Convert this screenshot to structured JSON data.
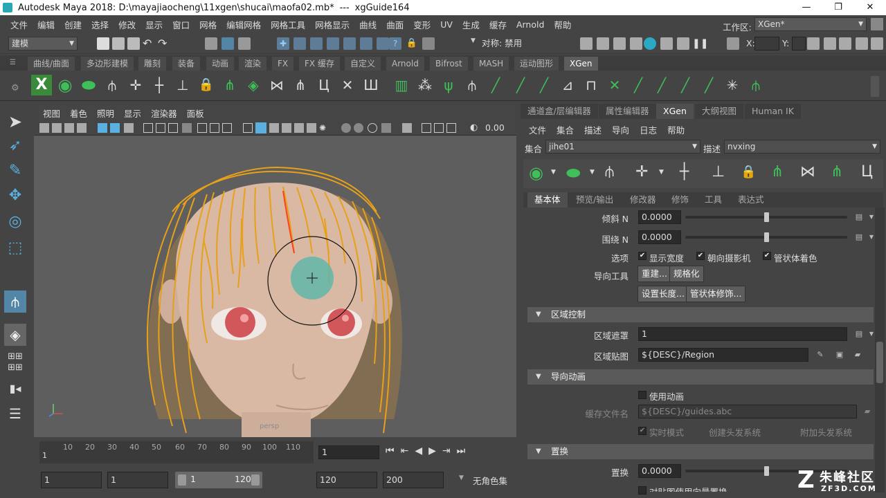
{
  "window": {
    "app_title": "Autodesk Maya 2018: D:\\mayajiaocheng\\11xgen\\shucai\\maofa02.mb*",
    "separator": "---",
    "doc_title": "xgGuide164"
  },
  "menubar": [
    "文件",
    "编辑",
    "创建",
    "选择",
    "修改",
    "显示",
    "窗口",
    "网格",
    "编辑网格",
    "网格工具",
    "网格显示",
    "曲线",
    "曲面",
    "变形",
    "UV",
    "生成",
    "缓存",
    "Arnold",
    "帮助"
  ],
  "status_line": {
    "mode": "建模",
    "symmetry": "对称: 禁用",
    "x_label": "X:",
    "y_label": "Y:",
    "workspace_label": "工作区:",
    "workspace_value": "XGen*"
  },
  "shelf_tabs": [
    "曲线/曲面",
    "多边形建模",
    "雕刻",
    "装备",
    "动画",
    "渲染",
    "FX",
    "FX 缓存",
    "自定义",
    "Arnold",
    "Bifrost",
    "MASH",
    "运动图形",
    "XGen"
  ],
  "shelf_active": "XGen",
  "viewport": {
    "menu": [
      "视图",
      "着色",
      "照明",
      "显示",
      "渲染器",
      "面板"
    ],
    "exposure_value": "0.00",
    "camera_label": "persp"
  },
  "timeline": {
    "ticks": [
      "10",
      "20",
      "30",
      "40",
      "50",
      "60",
      "70",
      "80",
      "90",
      "100",
      "110"
    ],
    "start_tick": "1",
    "current_frame": "1"
  },
  "range": {
    "start": "1",
    "playback_start": "1",
    "slider_start": "1",
    "slider_end": "120",
    "playback_end": "120",
    "end": "200",
    "character_set": "无角色集"
  },
  "panel": {
    "tabs": [
      "通道盒/层编辑器",
      "属性编辑器",
      "XGen",
      "大纲视图",
      "Human IK"
    ],
    "active_tab": "XGen",
    "menu": [
      "文件",
      "集合",
      "描述",
      "导向",
      "日志",
      "帮助"
    ],
    "collection_label": "集合",
    "collection_value": "jihe01",
    "description_label": "描述",
    "description_value": "nvxing",
    "subtabs": [
      "基本体",
      "预览/输出",
      "修改器",
      "修饰",
      "工具",
      "表达式"
    ],
    "active_subtab": "基本体",
    "lean_label": "倾斜 N",
    "lean_value": "0.0000",
    "lean_level": 0.5,
    "twist_label": "围绕 N",
    "twist_value": "0.0000",
    "twist_level": 0.5,
    "options_label": "选项",
    "opt_show_width": "显示宽度",
    "opt_face_camera": "朝向摄影机",
    "opt_tube_shade": "管状体着色",
    "guide_tools_label": "导向工具",
    "btn_rebuild": "重建...",
    "btn_normalize": "规格化",
    "btn_set_length": "设置长度...",
    "btn_tube_fix": "管状体修饰...",
    "section_region": "区域控制",
    "region_mask_label": "区域遮罩",
    "region_mask_value": "1",
    "region_map_label": "区域贴图",
    "region_map_value": "${DESC}/Region",
    "section_guide_anim": "导向动画",
    "use_anim": "使用动画",
    "cache_file_label": "缓存文件名",
    "cache_file_value": "${DESC}/guides.abc",
    "live_mode": "实时模式",
    "create_hair_system": "创建头发系统",
    "attach_hair_system": "附加头发系统",
    "section_displace": "置换",
    "displace_label": "置换",
    "displace_value": "0.0000",
    "displace_level": 0.5,
    "cutoff_text": "对贴图使用向量置换"
  },
  "watermark": {
    "brand": "朱峰社区",
    "site": "ZF3D.COM"
  },
  "colors": {
    "bg": "#444444",
    "hair": "#e8a018",
    "skin": "#d9b8a4",
    "eye": "#d2575a",
    "brush": "#5fb6a8",
    "accent": "#5285a6"
  }
}
